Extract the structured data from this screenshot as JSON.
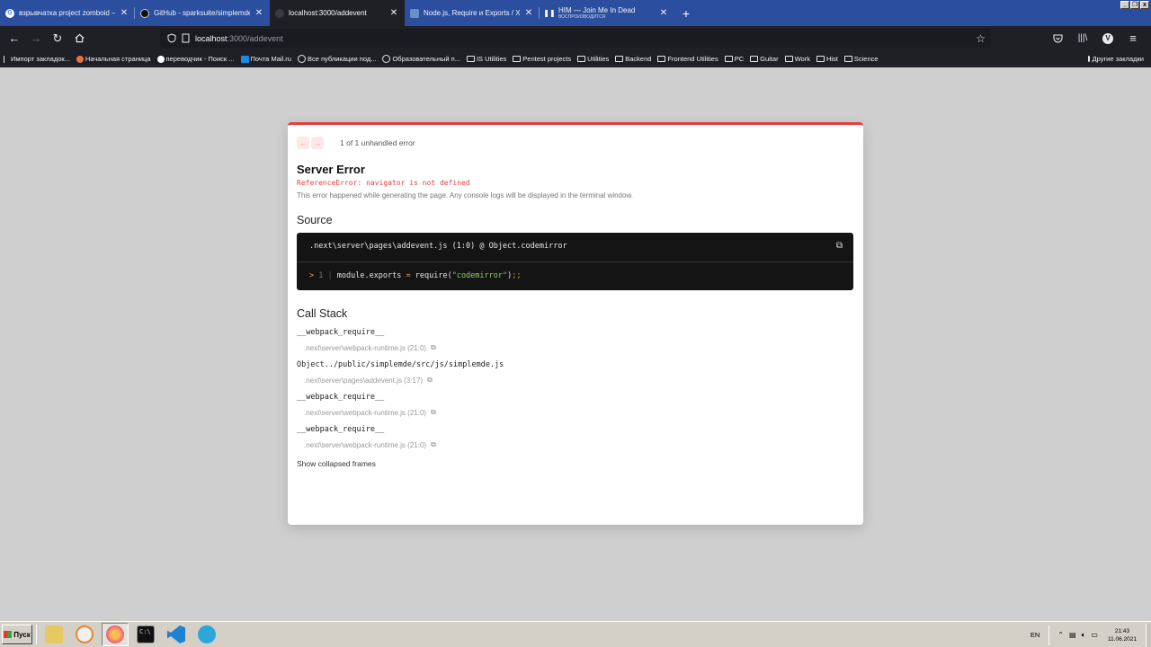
{
  "browser": {
    "tabs": [
      {
        "title": "взрывчатка project zomboid – Go",
        "subtitle": "",
        "icon": "google-icon",
        "active": false
      },
      {
        "title": "GitHub - sparksuite/simplemde-ma",
        "subtitle": "",
        "icon": "github-icon",
        "active": false
      },
      {
        "title": "localhost:3000/addevent",
        "subtitle": "",
        "icon": "globe-icon",
        "active": true
      },
      {
        "title": "Node.js, Require и Exports / Хабр",
        "subtitle": "",
        "icon": "habr-icon",
        "active": false
      },
      {
        "title": "HIM — Join Me In Dead",
        "subtitle": "ВОСПРОИЗВОДИТСЯ",
        "icon": "pause-icon",
        "active": false
      }
    ],
    "new_tab": "+",
    "url_host": "localhost",
    "url_path": ":3000/addevent",
    "bookmarks": [
      {
        "label": "Импорт закладок...",
        "icon": "import-icon"
      },
      {
        "label": "Начальная страница",
        "icon": "firefox-icon"
      },
      {
        "label": "переводчик - Поиск ...",
        "icon": "google-icon"
      },
      {
        "label": "Почта Mail.ru",
        "icon": "mail-icon"
      },
      {
        "label": "Все публикации под...",
        "icon": "globe-icon"
      },
      {
        "label": "Образовательный п...",
        "icon": "globe-icon"
      },
      {
        "label": "IS Utilities",
        "icon": "folder-icon"
      },
      {
        "label": "Pentest projects",
        "icon": "folder-icon"
      },
      {
        "label": "Utilities",
        "icon": "folder-icon"
      },
      {
        "label": "Backend",
        "icon": "folder-icon"
      },
      {
        "label": "Frontend Utilities",
        "icon": "folder-icon"
      },
      {
        "label": "PC",
        "icon": "folder-icon"
      },
      {
        "label": "Guitar",
        "icon": "folder-icon"
      },
      {
        "label": "Work",
        "icon": "folder-icon"
      },
      {
        "label": "Hist",
        "icon": "folder-icon"
      },
      {
        "label": "Science",
        "icon": "folder-icon"
      }
    ],
    "other_bookmarks": "Другие закладки"
  },
  "overlay": {
    "pager_text": "1 of 1 unhandled error",
    "title": "Server Error",
    "error_message": "ReferenceError: navigator is not defined",
    "description": "This error happened while generating the page. Any console logs will be displayed in the terminal window.",
    "source_heading": "Source",
    "source_file": ".next\\server\\pages\\addevent.js (1:0) @ Object.codemirror",
    "source_line_number": "1",
    "source_code": {
      "pre": "module.exports ",
      "op": "=",
      "mid": " require(",
      "str": "\"codemirror\"",
      "post": ")",
      "semi": ";;"
    },
    "callstack_heading": "Call Stack",
    "frames": [
      {
        "name": "__webpack_require__",
        "location": ".next\\server\\webpack-runtime.js (21:0)"
      },
      {
        "name": "Object../public/simplemde/src/js/simplemde.js",
        "location": ".next\\server\\pages\\addevent.js (3:17)"
      },
      {
        "name": "__webpack_require__",
        "location": ".next\\server\\webpack-runtime.js (21:0)"
      },
      {
        "name": "__webpack_require__",
        "location": ".next\\server\\webpack-runtime.js (21:0)"
      }
    ],
    "show_collapsed": "Show collapsed frames"
  },
  "taskbar": {
    "start_label": "Пуск",
    "apps": [
      "folder-icon",
      "media-player-icon",
      "firefox-icon",
      "terminal-icon",
      "vscode-icon",
      "telegram-icon"
    ],
    "lang": "EN",
    "time": "21:43",
    "date": "11.06.2021"
  },
  "colors": {
    "tabbar": "#2b4f9e",
    "chrome_dark": "#1f1f26",
    "error_red": "#e53e3e",
    "page_bg": "#cfcfcf"
  }
}
